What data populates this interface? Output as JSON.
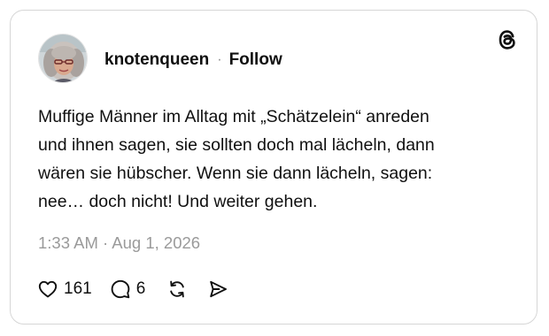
{
  "post": {
    "author": {
      "username": "knotenqueen",
      "avatar_icon": "profile-photo"
    },
    "separator": "·",
    "follow_label": "Follow",
    "brand_icon": "threads-logo-icon",
    "text_lines": [
      "Muffige Männer im Alltag mit „Schätzelein“ anreden",
      "und ihnen sagen, sie sollten doch mal lächeln, dann",
      "wären sie hübscher. Wenn sie dann lächeln, sagen:",
      "nee… doch nicht! Und weiter gehen."
    ],
    "timestamp": "1:33 AM · Aug 1, 2026",
    "actions": {
      "likes": "161",
      "replies": "6",
      "like_icon": "heart-icon",
      "reply_icon": "comment-icon",
      "repost_icon": "repost-icon",
      "share_icon": "share-icon"
    }
  },
  "colors": {
    "text": "#101010",
    "muted": "#9a9a9a",
    "border": "#d6d6d6"
  }
}
